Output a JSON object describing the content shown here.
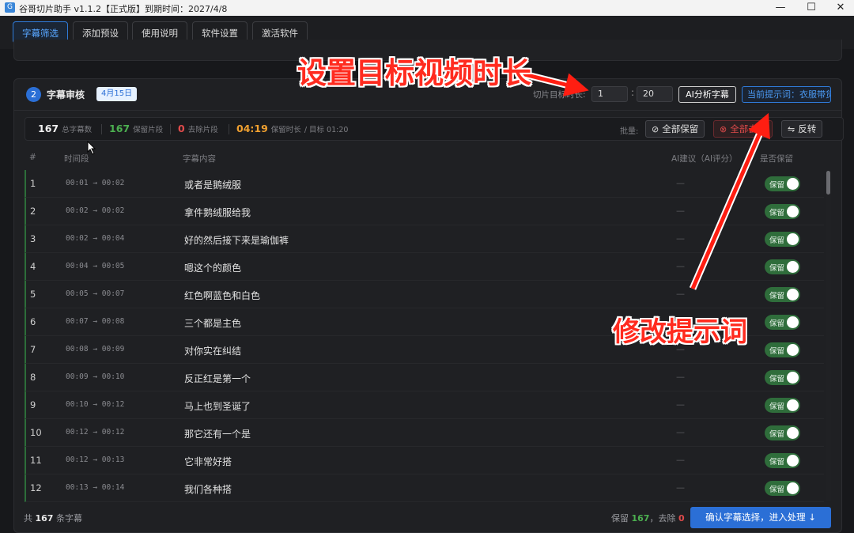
{
  "window": {
    "title": "谷哥切片助手 v1.1.2【正式版】到期时间：2027/4/8",
    "icon": "app-logo-icon",
    "controls": [
      "—",
      "☐",
      "✕"
    ]
  },
  "menu": [
    {
      "label": "字幕筛选",
      "active": true
    },
    {
      "label": "添加预设"
    },
    {
      "label": "使用说明"
    },
    {
      "label": "软件设置"
    },
    {
      "label": "激活软件"
    }
  ],
  "panel": {
    "step": "2",
    "title": "字幕审核",
    "date_badge": "4月15日",
    "duration_label": "切片目标时长:",
    "duration_min": "1",
    "duration_sec": "20",
    "ai_button": "AI分析字幕",
    "prompt_button": "当前提示词：衣服带货"
  },
  "stats": {
    "total_value": "167",
    "total_label": "总字幕数",
    "kept_value": "167",
    "kept_label": "保留片段",
    "removed_value": "0",
    "removed_label": "去除片段",
    "keep_time_value": "04:19",
    "keep_time_label": "保留时长",
    "target_label": "/ 目标 01:20",
    "batch_label": "批量:",
    "keep_all": "全部保留",
    "remove_all": "全部去除",
    "invert": "反转"
  },
  "table": {
    "headers": [
      "#",
      "时间段",
      "字幕内容",
      "AI建议（AI评分）",
      "是否保留"
    ],
    "toggle_label": "保留",
    "rows": [
      {
        "idx": "1",
        "time": "00:01 → 00:02",
        "text": "或者是鹅绒服",
        "ai": "—"
      },
      {
        "idx": "2",
        "time": "00:02 → 00:02",
        "text": "拿件鹅绒服给我",
        "ai": "—"
      },
      {
        "idx": "3",
        "time": "00:02 → 00:04",
        "text": "好的然后接下来是瑜伽裤",
        "ai": "—"
      },
      {
        "idx": "4",
        "time": "00:04 → 00:05",
        "text": "嗯这个的颜色",
        "ai": "—"
      },
      {
        "idx": "5",
        "time": "00:05 → 00:07",
        "text": "红色啊蓝色和白色",
        "ai": "—"
      },
      {
        "idx": "6",
        "time": "00:07 → 00:08",
        "text": "三个都是主色",
        "ai": "—"
      },
      {
        "idx": "7",
        "time": "00:08 → 00:09",
        "text": "对你实在纠结",
        "ai": "—"
      },
      {
        "idx": "8",
        "time": "00:09 → 00:10",
        "text": "反正红是第一个",
        "ai": "—"
      },
      {
        "idx": "9",
        "time": "00:10 → 00:12",
        "text": "马上也到圣诞了",
        "ai": "—"
      },
      {
        "idx": "10",
        "time": "00:12 → 00:12",
        "text": "那它还有一个是",
        "ai": "—"
      },
      {
        "idx": "11",
        "time": "00:12 → 00:13",
        "text": "它非常好搭",
        "ai": "—"
      },
      {
        "idx": "12",
        "time": "00:13 → 00:14",
        "text": "我们各种搭",
        "ai": "—"
      }
    ]
  },
  "footer": {
    "count_prefix": "共",
    "count_value": "167",
    "count_suffix": "条字幕",
    "keep_prefix": "保留",
    "keep_value": "167",
    "remove_prefix": "，去除",
    "remove_value": "0",
    "confirm": "确认字幕选择，进入处理 ↓"
  },
  "annotations": {
    "top": "设置目标视频时长",
    "bottom": "修改提示词",
    "color": "#ff2b1f"
  },
  "colors": {
    "accent": "#2b6fd6",
    "keep_green": "#4caf50",
    "danger_red": "#e04b4b",
    "time_orange": "#f0a030"
  }
}
